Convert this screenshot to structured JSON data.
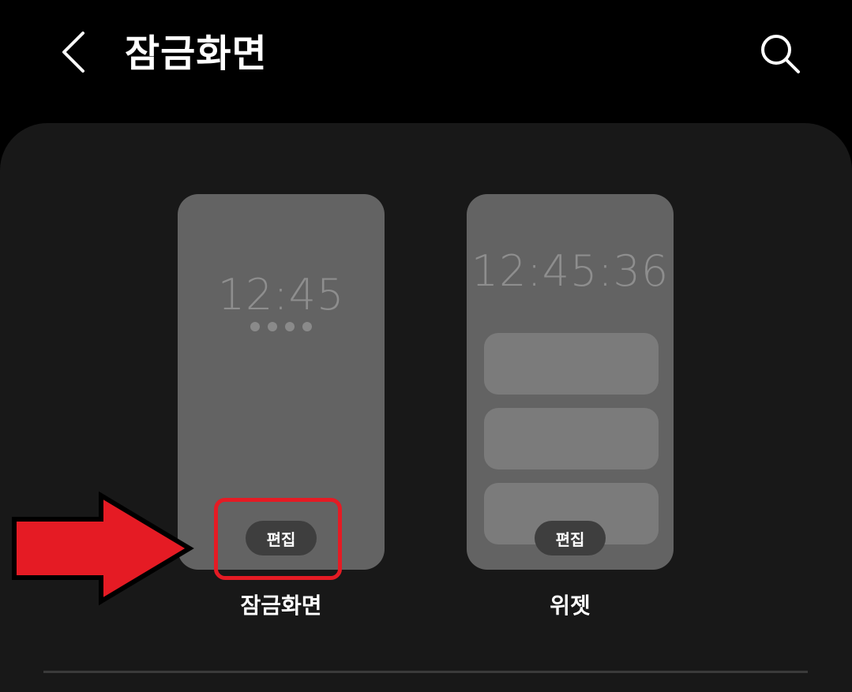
{
  "header": {
    "title": "잠금화면",
    "back_icon": "chevron-left-icon",
    "search_icon": "search-icon"
  },
  "previews": [
    {
      "id": "lock",
      "time": "12:45",
      "edit_label": "편집",
      "caption": "잠금화면",
      "pin_dots": 4
    },
    {
      "id": "widget",
      "time": "12:45:36",
      "edit_label": "편집",
      "caption": "위젯",
      "widget_placeholders": 3
    }
  ],
  "annotation": {
    "highlight_color": "#e51b24",
    "arrow_color": "#e51b24"
  },
  "colors": {
    "background": "#000000",
    "card": "#181818",
    "preview": "#636363",
    "edit_button": "#3e3e3e"
  }
}
